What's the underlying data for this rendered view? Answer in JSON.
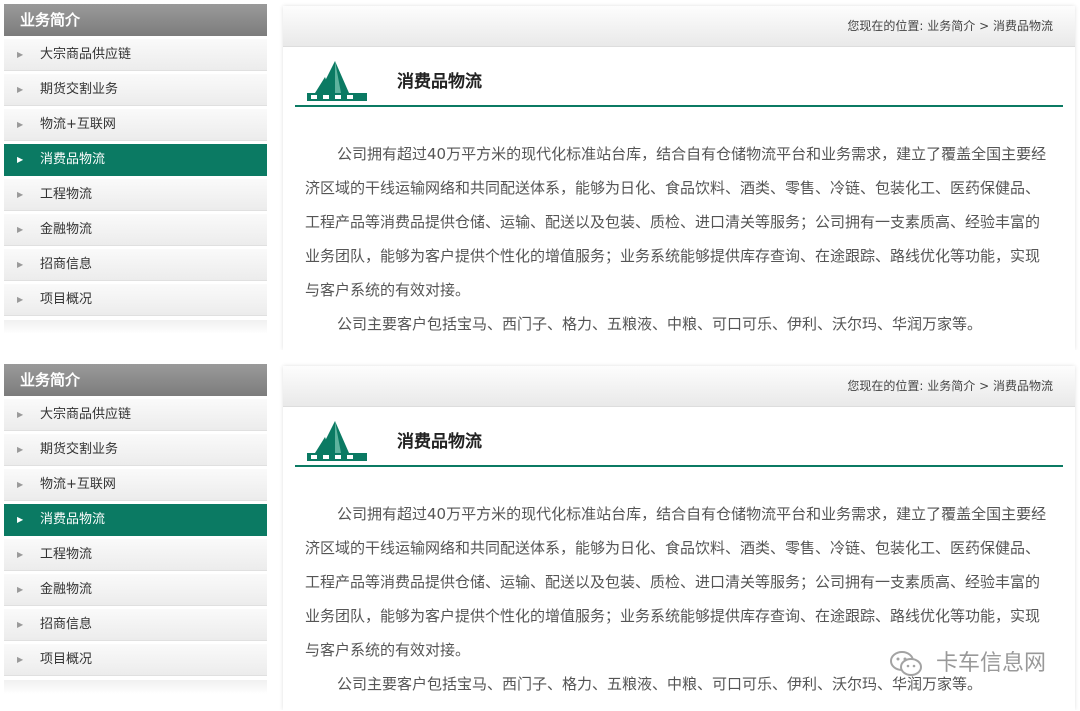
{
  "sidebar": {
    "title": "业务简介",
    "items": [
      {
        "label": "大宗商品供应链",
        "active": false
      },
      {
        "label": "期货交割业务",
        "active": false
      },
      {
        "label": "物流+互联网",
        "active": false
      },
      {
        "label": "消费品物流",
        "active": true
      },
      {
        "label": "工程物流",
        "active": false
      },
      {
        "label": "金融物流",
        "active": false
      },
      {
        "label": "招商信息",
        "active": false
      },
      {
        "label": "项目概况",
        "active": false
      }
    ]
  },
  "breadcrumb": {
    "prefix": "您现在的位置:",
    "level1": "业务简介",
    "separator": ">",
    "level2": "消费品物流"
  },
  "content": {
    "logo_icon": "company-logo",
    "title": "消费品物流",
    "paragraph1": "公司拥有超过40万平方米的现代化标准站台库，结合自有仓储物流平台和业务需求，建立了覆盖全国主要经济区域的干线运输网络和共同配送体系，能够为日化、食品饮料、酒类、零售、冷链、包装化工、医药保健品、工程产品等消费品提供仓储、运输、配送以及包装、质检、进口清关等服务；公司拥有一支素质高、经验丰富的业务团队，能够为客户提供个性化的增值服务；业务系统能够提供库存查询、在途跟踪、路线优化等功能，实现与客户系统的有效对接。",
    "paragraph2": "公司主要客户包括宝马、西门子、格力、五粮液、中粮、可口可乐、伊利、沃尔玛、华润万家等。"
  },
  "watermark": {
    "icon": "wechat-icon",
    "text": "卡车信息网"
  },
  "colors": {
    "accent": "#0b7a63",
    "sidebar_header": "#8a8a8a"
  }
}
